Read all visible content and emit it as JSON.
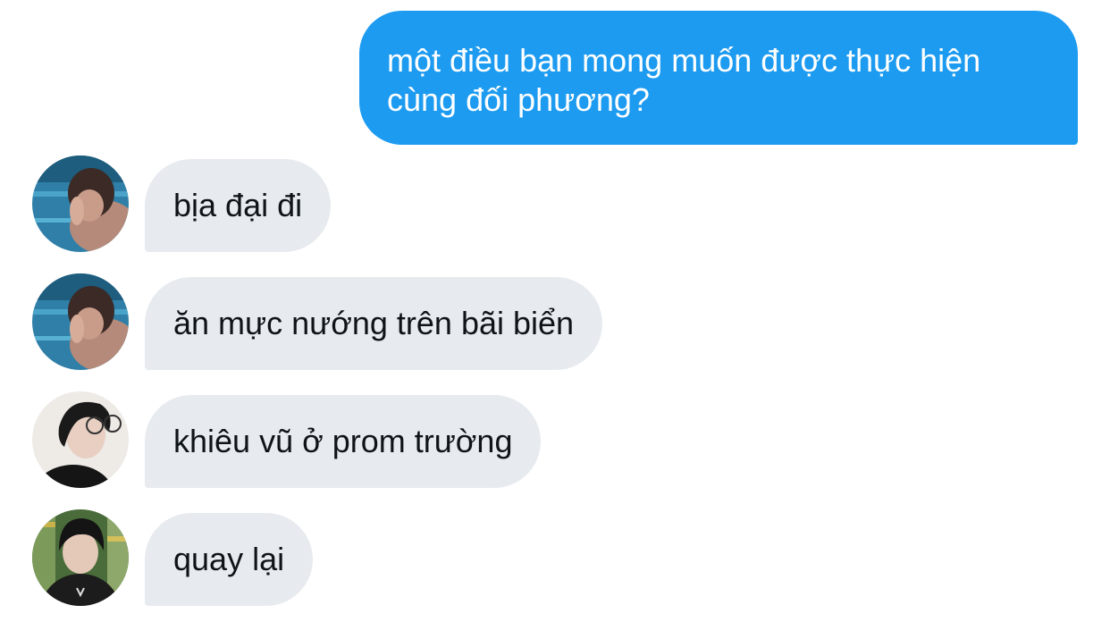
{
  "conversation": {
    "sent_message": "một điều bạn mong muốn được thực hiện cùng đối phương?",
    "received": [
      {
        "text": "bịa đại đi",
        "avatar": "avatar-pool-photo"
      },
      {
        "text": "ăn mực nướng trên bãi biển",
        "avatar": "avatar-pool-photo"
      },
      {
        "text": "khiêu vũ ở prom trường",
        "avatar": "avatar-glasses-photo"
      },
      {
        "text": "quay lại",
        "avatar": "avatar-hoodie-photo"
      }
    ]
  },
  "colors": {
    "sent_bubble": "#1d9bf0",
    "received_bubble": "#e7ebef",
    "text_dark": "#0f1419"
  }
}
